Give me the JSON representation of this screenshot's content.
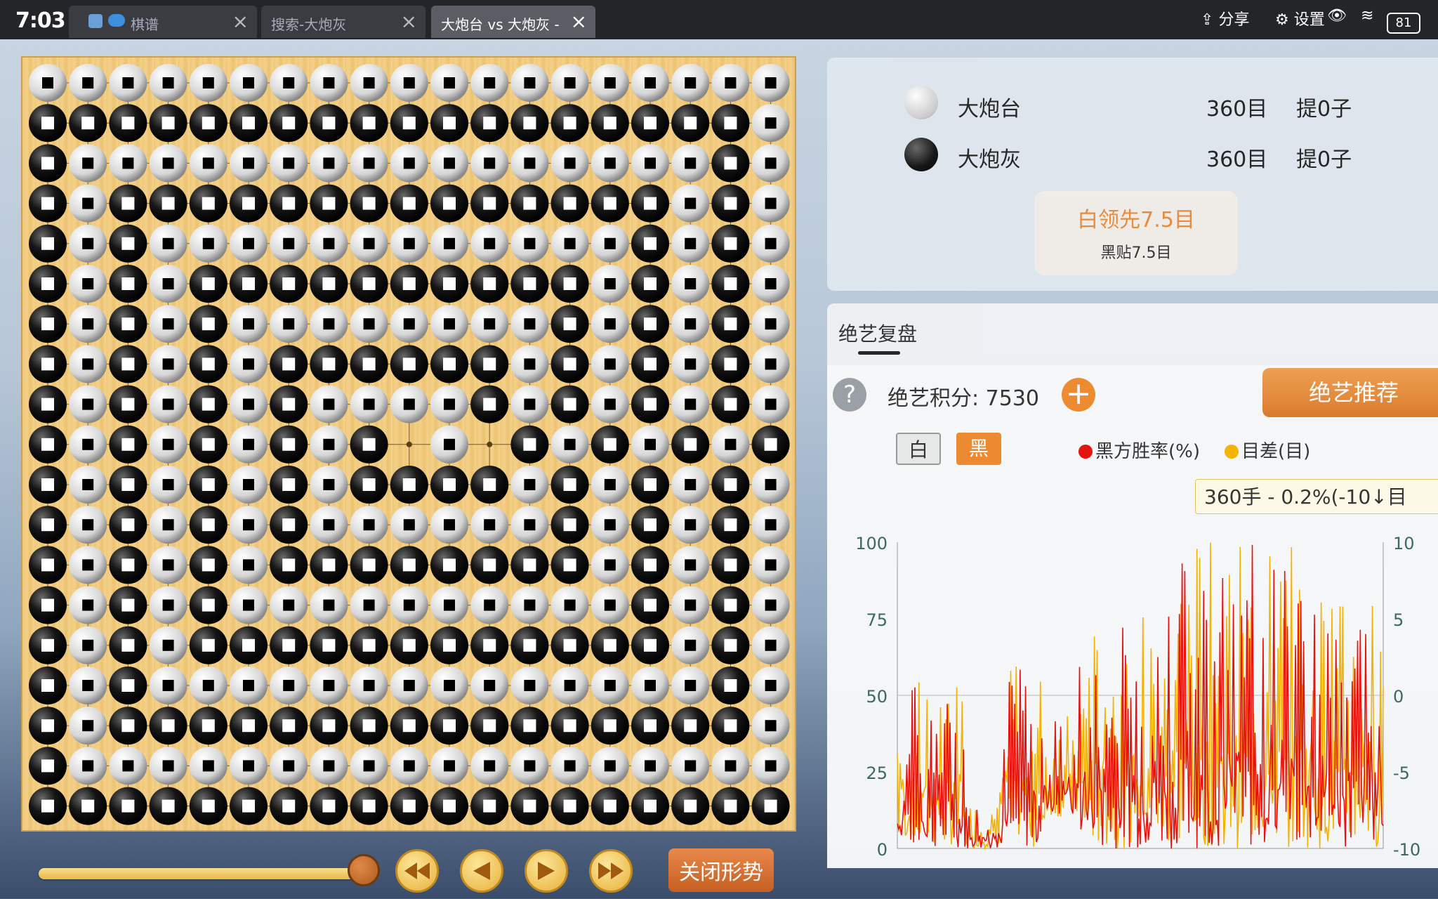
{
  "status_bar": {
    "time": "7:03",
    "share_label": "分享",
    "settings_label": "设置",
    "battery": "81"
  },
  "tabs": [
    {
      "label": "棋谱",
      "active": false
    },
    {
      "label": "搜索-大炮灰",
      "active": false
    },
    {
      "label": "大炮台 vs 大炮灰 -",
      "active": true
    }
  ],
  "board": {
    "size": 19,
    "rows": [
      "WWWWWWWWWWWWWWWWWWW",
      "BBBBBBBBBBBBBBBBBBW",
      "BWWWWWWWWWWWWWWWWBW",
      "BWBBBBBBBBBBBBBBWBW",
      "BWBWWWWWWWWWWWWBWBW",
      "BWBWBBBBBBBBBBWBWBW",
      "BWBWBWWWWWWWWBWBWBW",
      "BWBWBWBBBBBBWBWBWBW",
      "BWBWBWBWWWWBWBWBWBW",
      "BWBWBWBWB.W.BWBWBWBW",
      "BWBWBWBWBBBBWBWBWBW",
      "BWBWBWBWWWWWWBWBWBW",
      "BWBWBWBBBBBBBBWBWBW",
      "BWBWBWWWWWWWWWWBWBW",
      "BWBWBBBBBBBBBBBBWBW",
      "BWBWWWWWWWWWWWWWWBW",
      "BWBBBBBBBBBBBBBBBBW",
      "BWWWWWWWWWWWWWWWWWW",
      "BBBBBBBBBBBBBBBBBBB"
    ]
  },
  "controls": {
    "close_label": "关闭形势",
    "progress": 0.98
  },
  "players": [
    {
      "name": "大炮台",
      "color": "white",
      "score": "360目",
      "captures": "提0子"
    },
    {
      "name": "大炮灰",
      "color": "black",
      "score": "360目",
      "captures": "提0子"
    }
  ],
  "result": {
    "lead": "白领先7.5目",
    "komi": "黑贴7.5目"
  },
  "review": {
    "tab_label": "绝艺复盘",
    "score_label": "绝艺积分: 7530",
    "recommend_label": "绝艺推荐",
    "toggle_white": "白",
    "toggle_black": "黑",
    "tooltip": "360手 - 0.2%(-10↓目"
  },
  "chart_data": {
    "type": "line",
    "series": [
      {
        "name": "黑方胜率(%)",
        "color": "#e8110c"
      },
      {
        "name": "目差(目)",
        "color": "#f5b400"
      }
    ],
    "y_left_ticks": [
      "100",
      "75",
      "50",
      "25",
      "0"
    ],
    "y_right_ticks": [
      "10",
      "5",
      "0",
      "-5",
      "-10"
    ],
    "ylim_left": [
      0,
      100
    ],
    "ylim_right": [
      -10,
      10
    ],
    "moves": 360
  }
}
